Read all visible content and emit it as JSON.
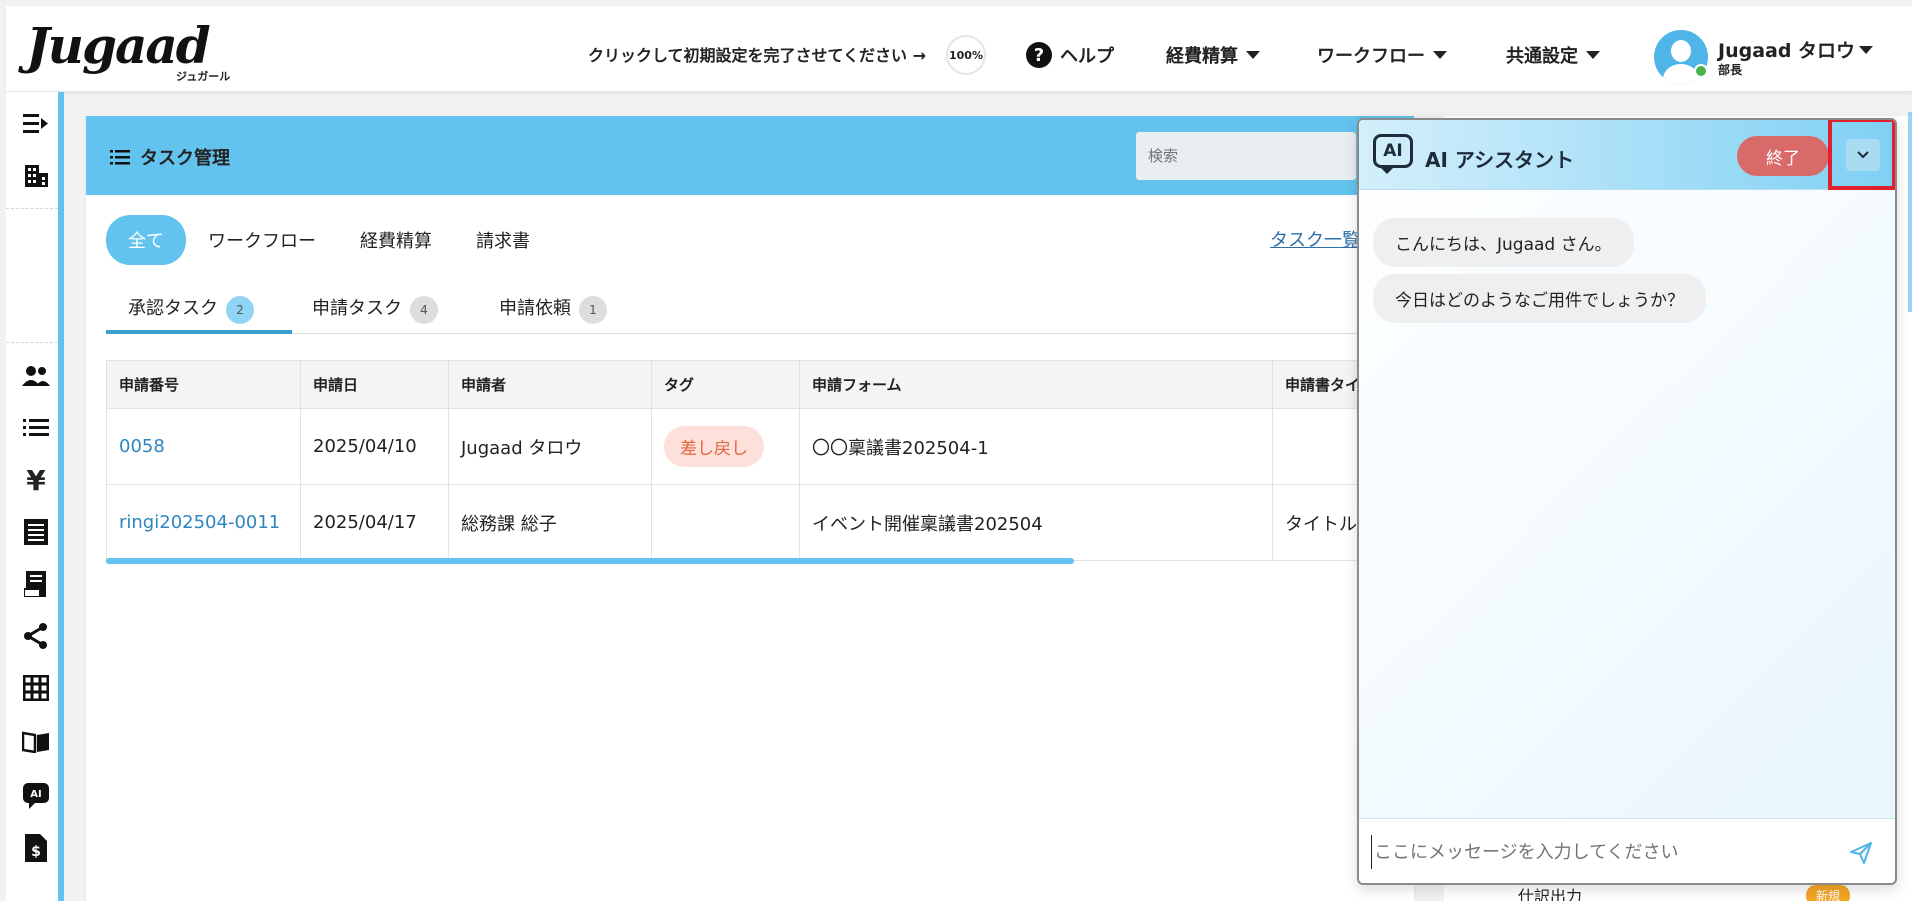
{
  "header": {
    "logo_main": "Jugaad",
    "logo_sub": "ジュガール",
    "setup_prompt": "クリックして初期設定を完了させてください →",
    "setup_progress": "100%",
    "help": "ヘルプ",
    "nav": [
      {
        "label": "経費精算"
      },
      {
        "label": "ワークフロー"
      },
      {
        "label": "共通設定"
      }
    ],
    "user": {
      "name": "Jugaad タロウ",
      "role": "部長"
    }
  },
  "main": {
    "title": "タスク管理",
    "search_placeholder": "検索",
    "category_tabs": [
      "全て",
      "ワークフロー",
      "経費精算",
      "請求書"
    ],
    "task_list_link": "タスク一覧",
    "sub_tabs": [
      {
        "label": "承認タスク",
        "count": "2"
      },
      {
        "label": "申請タスク",
        "count": "4"
      },
      {
        "label": "申請依頼",
        "count": "1"
      }
    ],
    "table": {
      "headers": [
        "申請番号",
        "申請日",
        "申請者",
        "タグ",
        "申請フォーム",
        "申請書タイ"
      ],
      "rows": [
        {
          "id": "0058",
          "date": "2025/04/10",
          "applicant": "Jugaad タロウ",
          "tag": "差し戻し",
          "form": "〇〇稟議書202504-1",
          "title": ""
        },
        {
          "id": "ringi202504-0011",
          "date": "2025/04/17",
          "applicant": "総務課 総子",
          "tag": "",
          "form": "イベント開催稟議書202504",
          "title": "タイトル"
        }
      ]
    }
  },
  "background": {
    "export_label": "仕訳出力",
    "new_badge": "新規"
  },
  "ai": {
    "title": "AI アシスタント",
    "logo_text": "AI",
    "end_button": "終了",
    "messages": [
      "こんにちは、Jugaad さん。",
      "今日はどのようなご用件でしょうか？"
    ],
    "input_placeholder": "ここにメッセージを入力してください"
  },
  "colors": {
    "accent": "#62c3ef",
    "danger": "#d96a6a",
    "link": "#2e86c1",
    "tag_text": "#e2643f"
  }
}
